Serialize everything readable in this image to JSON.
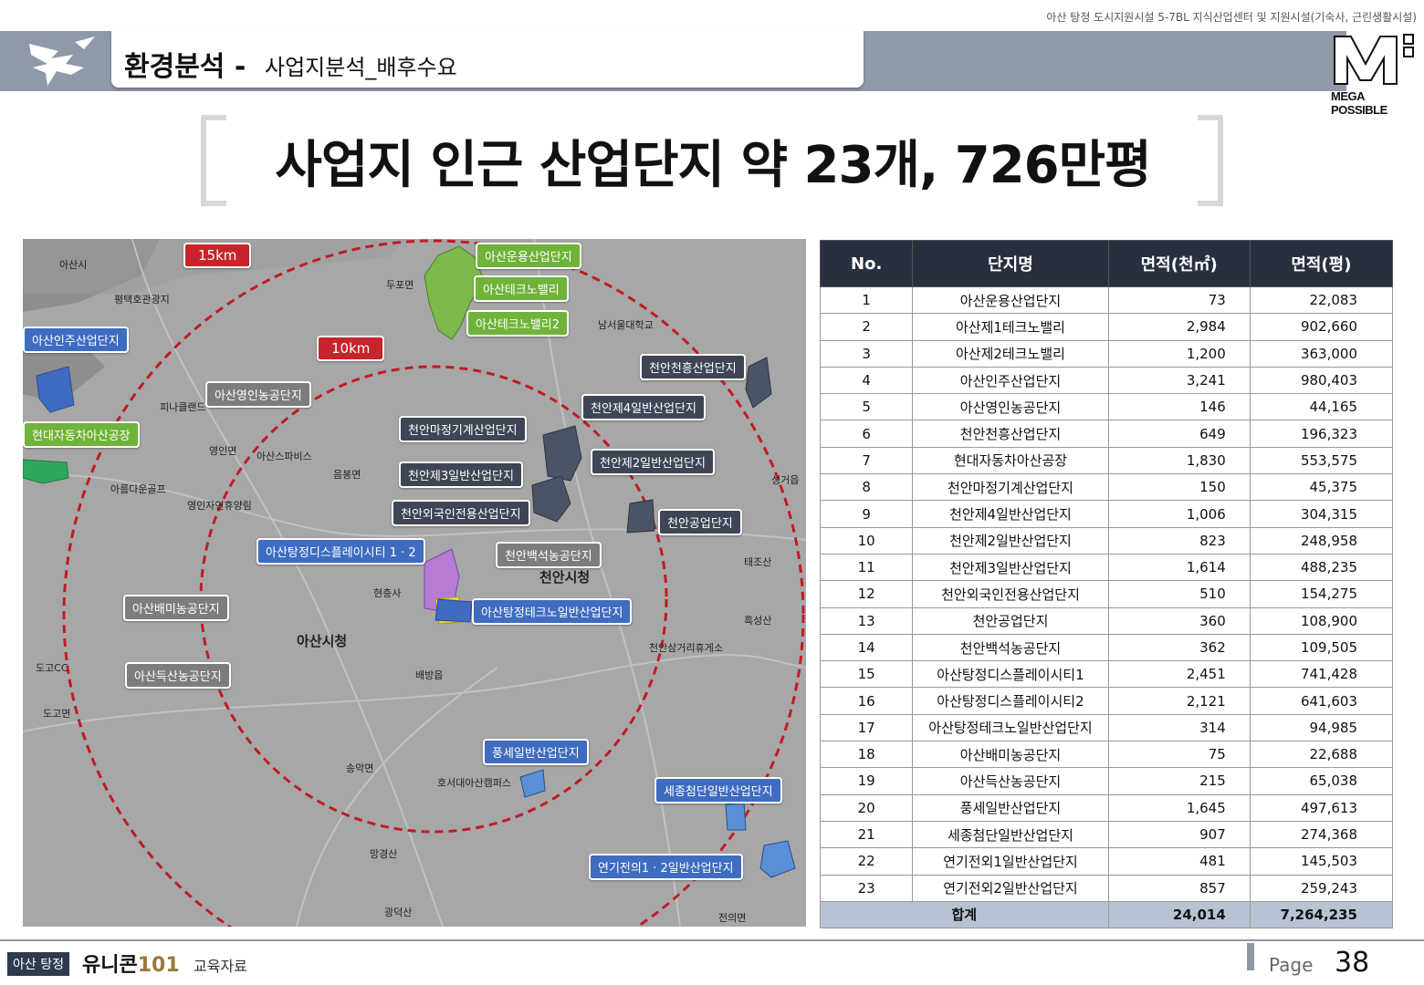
{
  "top_note": "아산 탕정 도시지원시설 5-7BL 지식산업센터 및 지원시설(기숙사, 근린생활시설)",
  "title": {
    "main": "환경분석 -",
    "sub": "사업지분석_배후수요"
  },
  "brand": {
    "name": "MEGA POSSIBLE"
  },
  "headline": "사업지 인근 산업단지 약 23개, 726만평",
  "map": {
    "rings": {
      "outer": "15km",
      "inner": "10km"
    },
    "labels": [
      {
        "text": "아산운용산업단지",
        "style": "green"
      },
      {
        "text": "아산테크노밸리",
        "style": "green"
      },
      {
        "text": "아산테크노밸리2",
        "style": "green"
      },
      {
        "text": "아산인주산업단지",
        "style": "blue"
      },
      {
        "text": "현대자동차아산공장",
        "style": "green"
      },
      {
        "text": "아산영인농공단지",
        "style": "grey"
      },
      {
        "text": "천안천흥산업단지",
        "style": "dark"
      },
      {
        "text": "천안제4일반산업단지",
        "style": "dark"
      },
      {
        "text": "천안마정기계산업단지",
        "style": "dark"
      },
      {
        "text": "천안제2일반산업단지",
        "style": "dark"
      },
      {
        "text": "천안제3일반산업단지",
        "style": "dark"
      },
      {
        "text": "천안외국인전용산업단지",
        "style": "dark"
      },
      {
        "text": "천안공업단지",
        "style": "dark"
      },
      {
        "text": "아산탕정디스플레이시티 1 · 2",
        "style": "blue"
      },
      {
        "text": "천안백석농공단지",
        "style": "grey"
      },
      {
        "text": "아산배미농공단지",
        "style": "grey"
      },
      {
        "text": "아산탕정테크노일반산업단지",
        "style": "blue"
      },
      {
        "text": "아산득산농공단지",
        "style": "grey"
      },
      {
        "text": "풍세일반산업단지",
        "style": "blue"
      },
      {
        "text": "세종첨단일반산업단지",
        "style": "blue"
      },
      {
        "text": "연기전의1 · 2일반산업단지",
        "style": "blue"
      }
    ],
    "places": [
      "아산시청",
      "천안시청",
      "아산시",
      "평택호관광지",
      "두포면",
      "남서울대학교",
      "피나클랜드",
      "영인면",
      "아산스파비스",
      "음봉면",
      "아름다운골프",
      "영인자연휴양림",
      "현충사",
      "배방읍",
      "도고CC",
      "도고면",
      "송악면",
      "광덕산",
      "천안삼거리휴게소",
      "태조산",
      "흑성산",
      "성거읍",
      "호서대아산캠퍼스",
      "망경산",
      "전의면"
    ]
  },
  "table": {
    "headers": [
      "No.",
      "단지명",
      "면적(천㎡)",
      "면적(평)"
    ],
    "rows": [
      [
        "1",
        "아산운용산업단지",
        "73",
        "22,083"
      ],
      [
        "2",
        "아산제1테크노밸리",
        "2,984",
        "902,660"
      ],
      [
        "3",
        "아산제2테크노밸리",
        "1,200",
        "363,000"
      ],
      [
        "4",
        "아산인주산업단지",
        "3,241",
        "980,403"
      ],
      [
        "5",
        "아산영인농공단지",
        "146",
        "44,165"
      ],
      [
        "6",
        "천안천흥산업단지",
        "649",
        "196,323"
      ],
      [
        "7",
        "현대자동차아산공장",
        "1,830",
        "553,575"
      ],
      [
        "8",
        "천안마정기계산업단지",
        "150",
        "45,375"
      ],
      [
        "9",
        "천안제4일반산업단지",
        "1,006",
        "304,315"
      ],
      [
        "10",
        "천안제2일반산업단지",
        "823",
        "248,958"
      ],
      [
        "11",
        "천안제3일반산업단지",
        "1,614",
        "488,235"
      ],
      [
        "12",
        "천안외국인전용산업단지",
        "510",
        "154,275"
      ],
      [
        "13",
        "천안공업단지",
        "360",
        "108,900"
      ],
      [
        "14",
        "천안백석농공단지",
        "362",
        "109,505"
      ],
      [
        "15",
        "아산탕정디스플레이시티1",
        "2,451",
        "741,428"
      ],
      [
        "16",
        "아산탕정디스플레이시티2",
        "2,121",
        "641,603"
      ],
      [
        "17",
        "아산탕정테크노일반산업단지",
        "314",
        "94,985"
      ],
      [
        "18",
        "아산배미농공단지",
        "75",
        "22,688"
      ],
      [
        "19",
        "아산득산농공단지",
        "215",
        "65,038"
      ],
      [
        "20",
        "풍세일반산업단지",
        "1,645",
        "497,613"
      ],
      [
        "21",
        "세종첨단일반산업단지",
        "907",
        "274,368"
      ],
      [
        "22",
        "연기전외1일반산업단지",
        "481",
        "145,503"
      ],
      [
        "23",
        "연기전외2일반산업단지",
        "857",
        "259,243"
      ]
    ],
    "total": {
      "label": "합계",
      "area_m2": "24,014",
      "area_py": "7,264,235"
    }
  },
  "footer": {
    "badge": "아산 탕정",
    "brand": "유니콘",
    "brand_num": "101",
    "sub": "교육자료",
    "page_label": "Page",
    "page_number": "38"
  }
}
